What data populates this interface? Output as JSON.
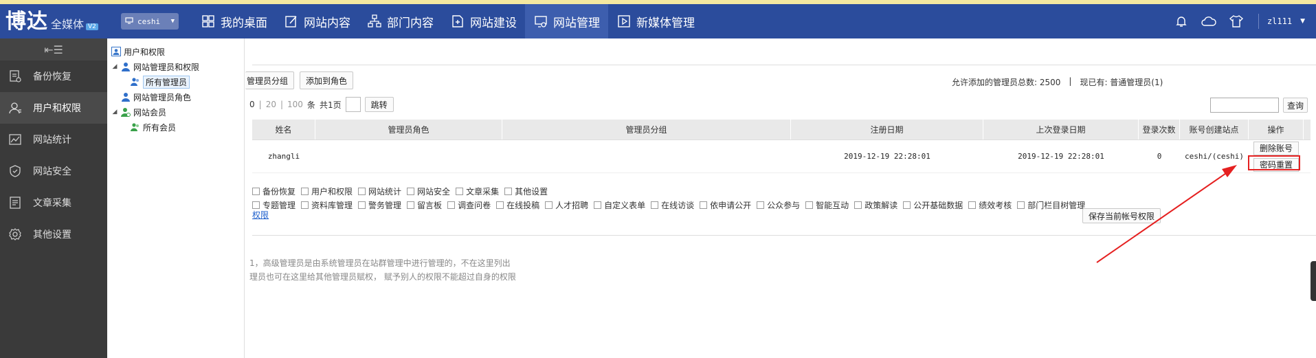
{
  "header": {
    "logo_main": "博达",
    "logo_sub": "全媒体",
    "logo_badge": "V2",
    "site_select": "ceshi",
    "nav": [
      {
        "label": "我的桌面",
        "icon": "desktop-icon"
      },
      {
        "label": "网站内容",
        "icon": "edit-icon"
      },
      {
        "label": "部门内容",
        "icon": "org-icon"
      },
      {
        "label": "网站建设",
        "icon": "build-icon"
      },
      {
        "label": "网站管理",
        "icon": "manage-icon",
        "active": true
      },
      {
        "label": "新媒体管理",
        "icon": "media-icon"
      }
    ],
    "user": "zl111"
  },
  "sidebar": {
    "items": [
      {
        "label": "备份恢复",
        "icon": "backup-icon"
      },
      {
        "label": "用户和权限",
        "icon": "user-icon",
        "active": true
      },
      {
        "label": "网站统计",
        "icon": "stats-icon"
      },
      {
        "label": "网站安全",
        "icon": "shield-icon"
      },
      {
        "label": "文章采集",
        "icon": "collect-icon"
      },
      {
        "label": "其他设置",
        "icon": "gear-icon"
      }
    ]
  },
  "tree": {
    "root": "用户和权限",
    "admins": "网站管理员和权限",
    "all_admins": "所有管理员",
    "admin_roles": "网站管理员角色",
    "members": "网站会员",
    "all_members": "所有会员"
  },
  "toolbar": {
    "group_btn": "管理员分组",
    "add_role_btn": "添加到角色",
    "quota": "允许添加的管理员总数: 2500",
    "quota_sep": "|",
    "current": "现已有: 普通管理员(1)"
  },
  "pager": {
    "size_a": "0",
    "size_b": "20",
    "size_c": "100",
    "unit": "条",
    "pages": "共1页",
    "jump": "跳转"
  },
  "search": {
    "button": "查询"
  },
  "table": {
    "headers": [
      "姓名",
      "管理员角色",
      "管理员分组",
      "注册日期",
      "上次登录日期",
      "登录次数",
      "账号创建站点",
      "操作"
    ],
    "row": {
      "name": "zhangli",
      "role": "",
      "group": "",
      "reg_date": "2019-12-19 22:28:01",
      "last_login": "2019-12-19 22:28:01",
      "count": "0",
      "site": "ceshi/(ceshi)",
      "delete": "删除账号",
      "reset": "密码重置"
    }
  },
  "perms": {
    "row1": [
      "备份恢复",
      "用户和权限",
      "网站统计",
      "网站安全",
      "文章采集",
      "其他设置"
    ],
    "row2": [
      "专题管理",
      "资料库管理",
      "警务管理",
      "留言板",
      "调查问卷",
      "在线投稿",
      "人才招聘",
      "自定义表单",
      "在线访谈",
      "依申请公开",
      "公众参与",
      "智能互动",
      "政策解读",
      "公开基础数据",
      "绩效考核",
      "部门栏目树管理"
    ],
    "link": "权限",
    "save": "保存当前帐号权限"
  },
  "notes": {
    "line1": "1，高级管理员是由系统管理员在站群管理中进行管理的，不在这里列出",
    "line2": "理员也可在这里给其他管理员赋权， 赋予别人的权限不能超过自身的权限"
  },
  "colors": {
    "topbar": "#2b4c9c",
    "sidebar": "#3a3a3a",
    "highlight": "#e52020"
  }
}
